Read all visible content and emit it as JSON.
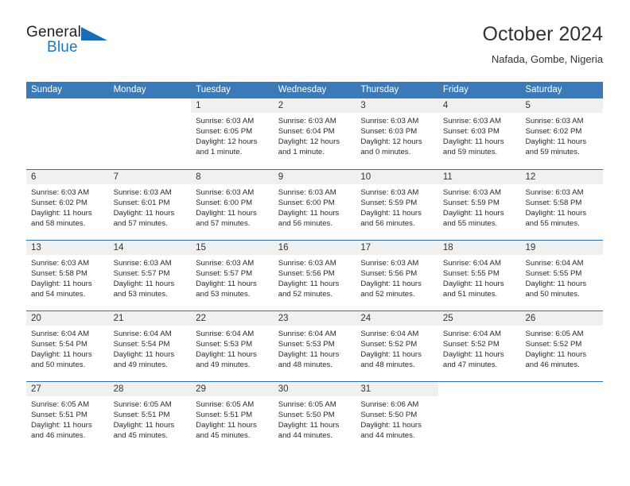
{
  "brand": {
    "word_top": "General",
    "word_bottom": "Blue",
    "triangle_icon": "triangle-icon",
    "accent_color": "#1878c0"
  },
  "header": {
    "title": "October 2024",
    "location": "Nafada, Gombe, Nigeria"
  },
  "colors": {
    "header_blue": "#3a7ab8",
    "rule_blue": "#2f6fae",
    "date_band": "#f0f0f0"
  },
  "calendar": {
    "day_headers": [
      "Sunday",
      "Monday",
      "Tuesday",
      "Wednesday",
      "Thursday",
      "Friday",
      "Saturday"
    ],
    "weeks": [
      [
        {
          "day": "",
          "blank": true
        },
        {
          "day": "",
          "blank": true
        },
        {
          "day": "1",
          "sunrise": "Sunrise: 6:03 AM",
          "sunset": "Sunset: 6:05 PM",
          "daylight": "Daylight: 12 hours and 1 minute."
        },
        {
          "day": "2",
          "sunrise": "Sunrise: 6:03 AM",
          "sunset": "Sunset: 6:04 PM",
          "daylight": "Daylight: 12 hours and 1 minute."
        },
        {
          "day": "3",
          "sunrise": "Sunrise: 6:03 AM",
          "sunset": "Sunset: 6:03 PM",
          "daylight": "Daylight: 12 hours and 0 minutes."
        },
        {
          "day": "4",
          "sunrise": "Sunrise: 6:03 AM",
          "sunset": "Sunset: 6:03 PM",
          "daylight": "Daylight: 11 hours and 59 minutes."
        },
        {
          "day": "5",
          "sunrise": "Sunrise: 6:03 AM",
          "sunset": "Sunset: 6:02 PM",
          "daylight": "Daylight: 11 hours and 59 minutes."
        }
      ],
      [
        {
          "day": "6",
          "sunrise": "Sunrise: 6:03 AM",
          "sunset": "Sunset: 6:02 PM",
          "daylight": "Daylight: 11 hours and 58 minutes."
        },
        {
          "day": "7",
          "sunrise": "Sunrise: 6:03 AM",
          "sunset": "Sunset: 6:01 PM",
          "daylight": "Daylight: 11 hours and 57 minutes."
        },
        {
          "day": "8",
          "sunrise": "Sunrise: 6:03 AM",
          "sunset": "Sunset: 6:00 PM",
          "daylight": "Daylight: 11 hours and 57 minutes."
        },
        {
          "day": "9",
          "sunrise": "Sunrise: 6:03 AM",
          "sunset": "Sunset: 6:00 PM",
          "daylight": "Daylight: 11 hours and 56 minutes."
        },
        {
          "day": "10",
          "sunrise": "Sunrise: 6:03 AM",
          "sunset": "Sunset: 5:59 PM",
          "daylight": "Daylight: 11 hours and 56 minutes."
        },
        {
          "day": "11",
          "sunrise": "Sunrise: 6:03 AM",
          "sunset": "Sunset: 5:59 PM",
          "daylight": "Daylight: 11 hours and 55 minutes."
        },
        {
          "day": "12",
          "sunrise": "Sunrise: 6:03 AM",
          "sunset": "Sunset: 5:58 PM",
          "daylight": "Daylight: 11 hours and 55 minutes."
        }
      ],
      [
        {
          "day": "13",
          "sunrise": "Sunrise: 6:03 AM",
          "sunset": "Sunset: 5:58 PM",
          "daylight": "Daylight: 11 hours and 54 minutes."
        },
        {
          "day": "14",
          "sunrise": "Sunrise: 6:03 AM",
          "sunset": "Sunset: 5:57 PM",
          "daylight": "Daylight: 11 hours and 53 minutes."
        },
        {
          "day": "15",
          "sunrise": "Sunrise: 6:03 AM",
          "sunset": "Sunset: 5:57 PM",
          "daylight": "Daylight: 11 hours and 53 minutes."
        },
        {
          "day": "16",
          "sunrise": "Sunrise: 6:03 AM",
          "sunset": "Sunset: 5:56 PM",
          "daylight": "Daylight: 11 hours and 52 minutes."
        },
        {
          "day": "17",
          "sunrise": "Sunrise: 6:03 AM",
          "sunset": "Sunset: 5:56 PM",
          "daylight": "Daylight: 11 hours and 52 minutes."
        },
        {
          "day": "18",
          "sunrise": "Sunrise: 6:04 AM",
          "sunset": "Sunset: 5:55 PM",
          "daylight": "Daylight: 11 hours and 51 minutes."
        },
        {
          "day": "19",
          "sunrise": "Sunrise: 6:04 AM",
          "sunset": "Sunset: 5:55 PM",
          "daylight": "Daylight: 11 hours and 50 minutes."
        }
      ],
      [
        {
          "day": "20",
          "sunrise": "Sunrise: 6:04 AM",
          "sunset": "Sunset: 5:54 PM",
          "daylight": "Daylight: 11 hours and 50 minutes."
        },
        {
          "day": "21",
          "sunrise": "Sunrise: 6:04 AM",
          "sunset": "Sunset: 5:54 PM",
          "daylight": "Daylight: 11 hours and 49 minutes."
        },
        {
          "day": "22",
          "sunrise": "Sunrise: 6:04 AM",
          "sunset": "Sunset: 5:53 PM",
          "daylight": "Daylight: 11 hours and 49 minutes."
        },
        {
          "day": "23",
          "sunrise": "Sunrise: 6:04 AM",
          "sunset": "Sunset: 5:53 PM",
          "daylight": "Daylight: 11 hours and 48 minutes."
        },
        {
          "day": "24",
          "sunrise": "Sunrise: 6:04 AM",
          "sunset": "Sunset: 5:52 PM",
          "daylight": "Daylight: 11 hours and 48 minutes."
        },
        {
          "day": "25",
          "sunrise": "Sunrise: 6:04 AM",
          "sunset": "Sunset: 5:52 PM",
          "daylight": "Daylight: 11 hours and 47 minutes."
        },
        {
          "day": "26",
          "sunrise": "Sunrise: 6:05 AM",
          "sunset": "Sunset: 5:52 PM",
          "daylight": "Daylight: 11 hours and 46 minutes."
        }
      ],
      [
        {
          "day": "27",
          "sunrise": "Sunrise: 6:05 AM",
          "sunset": "Sunset: 5:51 PM",
          "daylight": "Daylight: 11 hours and 46 minutes."
        },
        {
          "day": "28",
          "sunrise": "Sunrise: 6:05 AM",
          "sunset": "Sunset: 5:51 PM",
          "daylight": "Daylight: 11 hours and 45 minutes."
        },
        {
          "day": "29",
          "sunrise": "Sunrise: 6:05 AM",
          "sunset": "Sunset: 5:51 PM",
          "daylight": "Daylight: 11 hours and 45 minutes."
        },
        {
          "day": "30",
          "sunrise": "Sunrise: 6:05 AM",
          "sunset": "Sunset: 5:50 PM",
          "daylight": "Daylight: 11 hours and 44 minutes."
        },
        {
          "day": "31",
          "sunrise": "Sunrise: 6:06 AM",
          "sunset": "Sunset: 5:50 PM",
          "daylight": "Daylight: 11 hours and 44 minutes."
        },
        {
          "day": "",
          "blank": true
        },
        {
          "day": "",
          "blank": true
        }
      ]
    ]
  }
}
